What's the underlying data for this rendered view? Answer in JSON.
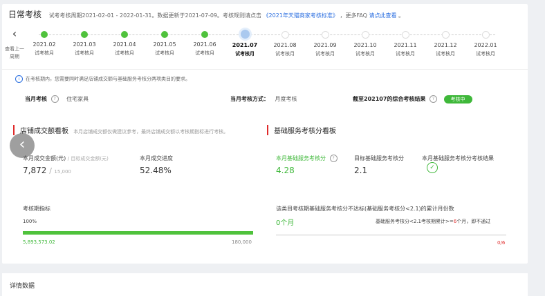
{
  "header": {
    "title": "日常考核",
    "description": "试考考核周期2021-02-01 - 2022-01-31。数据更新于2021-07-09。考核规则请点击",
    "rules_link": "《2021年天猫商家考核标准》",
    "faq_prefix": "，更多FAQ",
    "faq_link": "请点此查看",
    "faq_suffix": "。"
  },
  "timeline": {
    "back_label": "查看上一周期",
    "items": [
      {
        "date": "2021.02",
        "label": "试考核月",
        "state": "done"
      },
      {
        "date": "2021.03",
        "label": "试考核月",
        "state": "done"
      },
      {
        "date": "2021.04",
        "label": "试考核月",
        "state": "done"
      },
      {
        "date": "2021.05",
        "label": "试考核月",
        "state": "done"
      },
      {
        "date": "2021.06",
        "label": "试考核月",
        "state": "done"
      },
      {
        "date": "2021.07",
        "label": "试考核月",
        "state": "current"
      },
      {
        "date": "2021.08",
        "label": "试考核月",
        "state": "future"
      },
      {
        "date": "2021.09",
        "label": "试考核月",
        "state": "future"
      },
      {
        "date": "2021.10",
        "label": "试考核月",
        "state": "future"
      },
      {
        "date": "2021.11",
        "label": "试考核月",
        "state": "future"
      },
      {
        "date": "2021.12",
        "label": "试考核月",
        "state": "future"
      },
      {
        "date": "2022.01",
        "label": "试考核月",
        "state": "future"
      }
    ]
  },
  "notice": "在考核期内，您需要同时满足店铺成交额与基础服务考核分两项类目的要求。",
  "meta": {
    "current_assessment_label": "当月考核",
    "current_assessment_value": "住宅家具",
    "method_label": "当月考核方式：",
    "method_value": "月度考核",
    "result_label": "截至202107的综合考核结果",
    "result_badge": "考核中"
  },
  "store_panel": {
    "title": "店铺成交额看板",
    "note": "本月店铺成交额仅做建议参考，最终店铺成交额以考核期指标进行考核。",
    "gmv_label": "本月成交金额(元)",
    "target_label": "/ 目标成交金额(元)",
    "gmv_value": "7,872",
    "gmv_target": "15,000",
    "progress_label": "本月成交进度",
    "progress_value": "52.48%",
    "period_label": "考核期指标",
    "period_percent": "100%",
    "period_current": "5,893,573.02",
    "period_target": "180,000",
    "period_fill": 1.0
  },
  "service_panel": {
    "title": "基础服务考核分看板",
    "score_label": "本月基础服务考核分",
    "score_value": "4.28",
    "target_label": "目标基础服务考核分",
    "target_value": "2.1",
    "result_label": "本月基础服务考核分考核结果",
    "sub_notice": "该类目考核期基础服务考核分不达标(基础服务考核分<2.1)的累计月份数",
    "months_value": "0个月",
    "rule_prefix": "基础服务考核分<2.1考核期累计>=",
    "rule_highlight": "6",
    "rule_suffix": "个月，即不通过",
    "ratio_current": "0",
    "ratio_total": "/6"
  },
  "detail": {
    "title": "详情数据"
  },
  "colors": {
    "accent_green": "#3fb83a",
    "link_blue": "#2a6ee0",
    "section_red": "#e02a2a"
  }
}
